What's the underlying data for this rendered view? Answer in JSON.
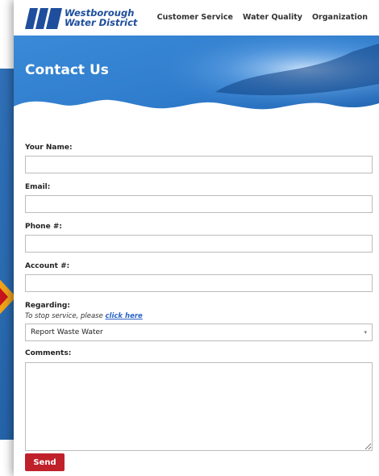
{
  "site": {
    "logo_line1": "Westborough",
    "logo_line2": "Water District",
    "brand_color": "#1e4e9c"
  },
  "nav": {
    "items": [
      "Customer Service",
      "Water Quality",
      "Organization"
    ]
  },
  "hero": {
    "title": "Contact Us"
  },
  "form": {
    "name_label": "Your Name:",
    "email_label": "Email:",
    "phone_label": "Phone #:",
    "account_label": "Account #:",
    "regarding_label": "Regarding:",
    "regarding_hint": "To stop service, please ",
    "regarding_link": "click here",
    "regarding_value": "Report Waste Water",
    "comments_label": "Comments:",
    "send_label": "Send"
  },
  "colors": {
    "send_button": "#c0202a",
    "background_blue": "#2f6fb6",
    "arrow_orange": "#f0a21a"
  }
}
